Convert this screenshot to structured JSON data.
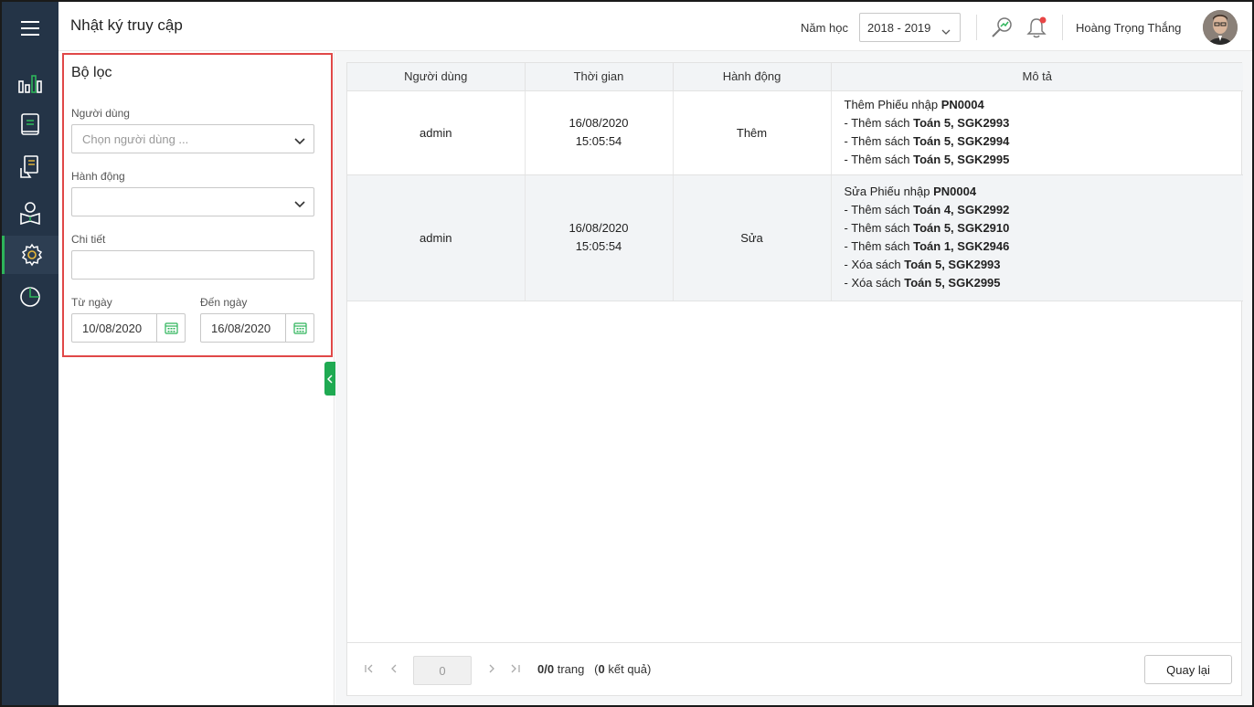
{
  "header": {
    "title": "Nhật ký truy cập",
    "year_label": "Năm học",
    "year_value": "2018 - 2019",
    "user_name": "Hoàng Trọng  Thắng"
  },
  "nav": {
    "items": [
      "menu",
      "dashboard",
      "books",
      "borrow",
      "readers",
      "settings",
      "reports"
    ],
    "active": "settings",
    "accent": "#2db45a"
  },
  "filter": {
    "title": "Bộ lọc",
    "user_label": "Người dùng",
    "user_placeholder": "Chọn người dùng ...",
    "action_label": "Hành động",
    "action_value": "",
    "detail_label": "Chi tiết",
    "detail_value": "",
    "from_label": "Từ ngày",
    "from_value": "10/08/2020",
    "to_label": "Đến ngày",
    "to_value": "16/08/2020"
  },
  "table": {
    "columns": [
      "Người dùng",
      "Thời gian",
      "Hành động",
      "Mô tả"
    ],
    "rows": [
      {
        "user": "admin",
        "date": "16/08/2020",
        "time": "15:05:54",
        "action": "Thêm",
        "desc": [
          {
            "text": "Thêm Phiếu nhập ",
            "bold": "PN0004"
          },
          {
            "text": "- Thêm sách ",
            "bold": "Toán 5, SGK2993"
          },
          {
            "text": "- Thêm sách ",
            "bold": "Toán 5, SGK2994"
          },
          {
            "text": "- Thêm sách ",
            "bold": "Toán 5, SGK2995"
          }
        ]
      },
      {
        "user": "admin",
        "date": "16/08/2020",
        "time": "15:05:54",
        "action": "Sửa",
        "desc": [
          {
            "text": "Sửa Phiếu nhập ",
            "bold": "PN0004"
          },
          {
            "text": "- Thêm sách ",
            "bold": "Toán 4, SGK2992"
          },
          {
            "text": "- Thêm sách ",
            "bold": "Toán 5, SGK2910"
          },
          {
            "text": "- Thêm sách ",
            "bold": "Toán 1, SGK2946"
          },
          {
            "text": "- Xóa sách ",
            "bold": "Toán 5, SGK2993"
          },
          {
            "text": "- Xóa sách ",
            "bold": "Toán 5, SGK2995"
          }
        ]
      }
    ]
  },
  "pager": {
    "page_input": "0",
    "pages": "0/0",
    "pages_word": "trang",
    "results_count": "0",
    "results_word": "kết quả",
    "back_label": "Quay lại"
  }
}
